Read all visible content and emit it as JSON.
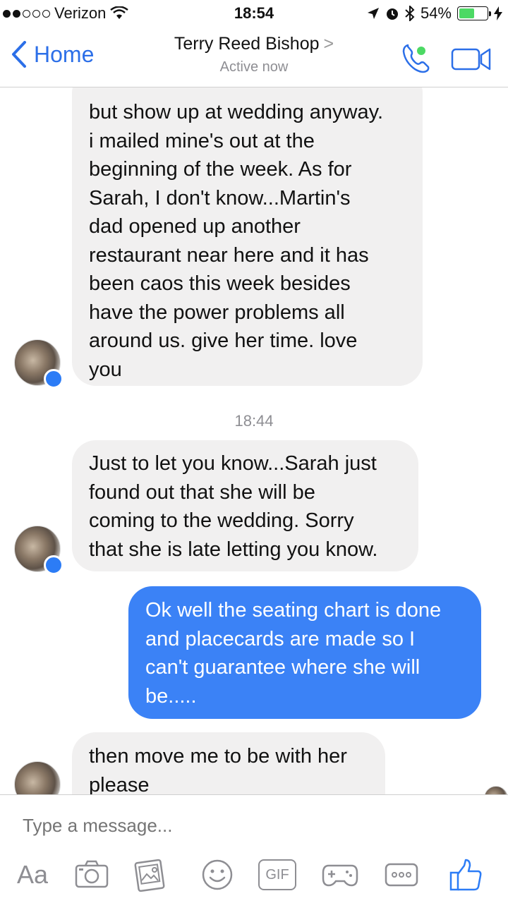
{
  "status_bar": {
    "carrier": "Verizon",
    "time": "18:54",
    "battery_percent": "54%",
    "battery_level": 0.54,
    "signal_bars_filled": 2,
    "signal_bars_total": 5
  },
  "nav": {
    "back_label": "Home",
    "contact_name": "Terry Reed Bishop",
    "contact_chevron": ">",
    "status": "Active now",
    "accent_color": "#2c6fe8",
    "icons": [
      "phone-icon",
      "video-camera-icon"
    ]
  },
  "messages": {
    "m1": {
      "direction": "incoming",
      "lines": [
        "but show up at wedding anyway.",
        "i mailed mine's out at the",
        "beginning of the week.  As for",
        "Sarah, I don't know...Martin's",
        "dad opened up another",
        "restaurant near here and it has",
        "been caos this week besides",
        "have the power problems all",
        "around us.  give her time.  love",
        "you"
      ]
    },
    "timestamp": "18:44",
    "m2": {
      "direction": "incoming",
      "lines": [
        "Just to let you know...Sarah just",
        "found out that she will be",
        "coming to the wedding.  Sorry",
        "that she is late letting you know."
      ]
    },
    "m3": {
      "direction": "outgoing",
      "lines": [
        "Ok well the seating chart is done",
        "and placecards are made so I",
        "can't guarantee where she will",
        "be....."
      ]
    },
    "m4": {
      "direction": "incoming",
      "lines": [
        "then move me to be with her",
        "please"
      ]
    }
  },
  "composer": {
    "placeholder": "Type a message...",
    "aa_label": "Aa",
    "gif_label": "GIF",
    "icons": [
      "camera-icon",
      "photo-icon",
      "emoji-icon",
      "gif-icon",
      "game-icon",
      "more-icon",
      "like-icon"
    ]
  },
  "colors": {
    "incoming_bubble": "#f1f0f0",
    "outgoing_bubble": "#3b82f6",
    "messenger_badge": "#2c7cf6"
  }
}
